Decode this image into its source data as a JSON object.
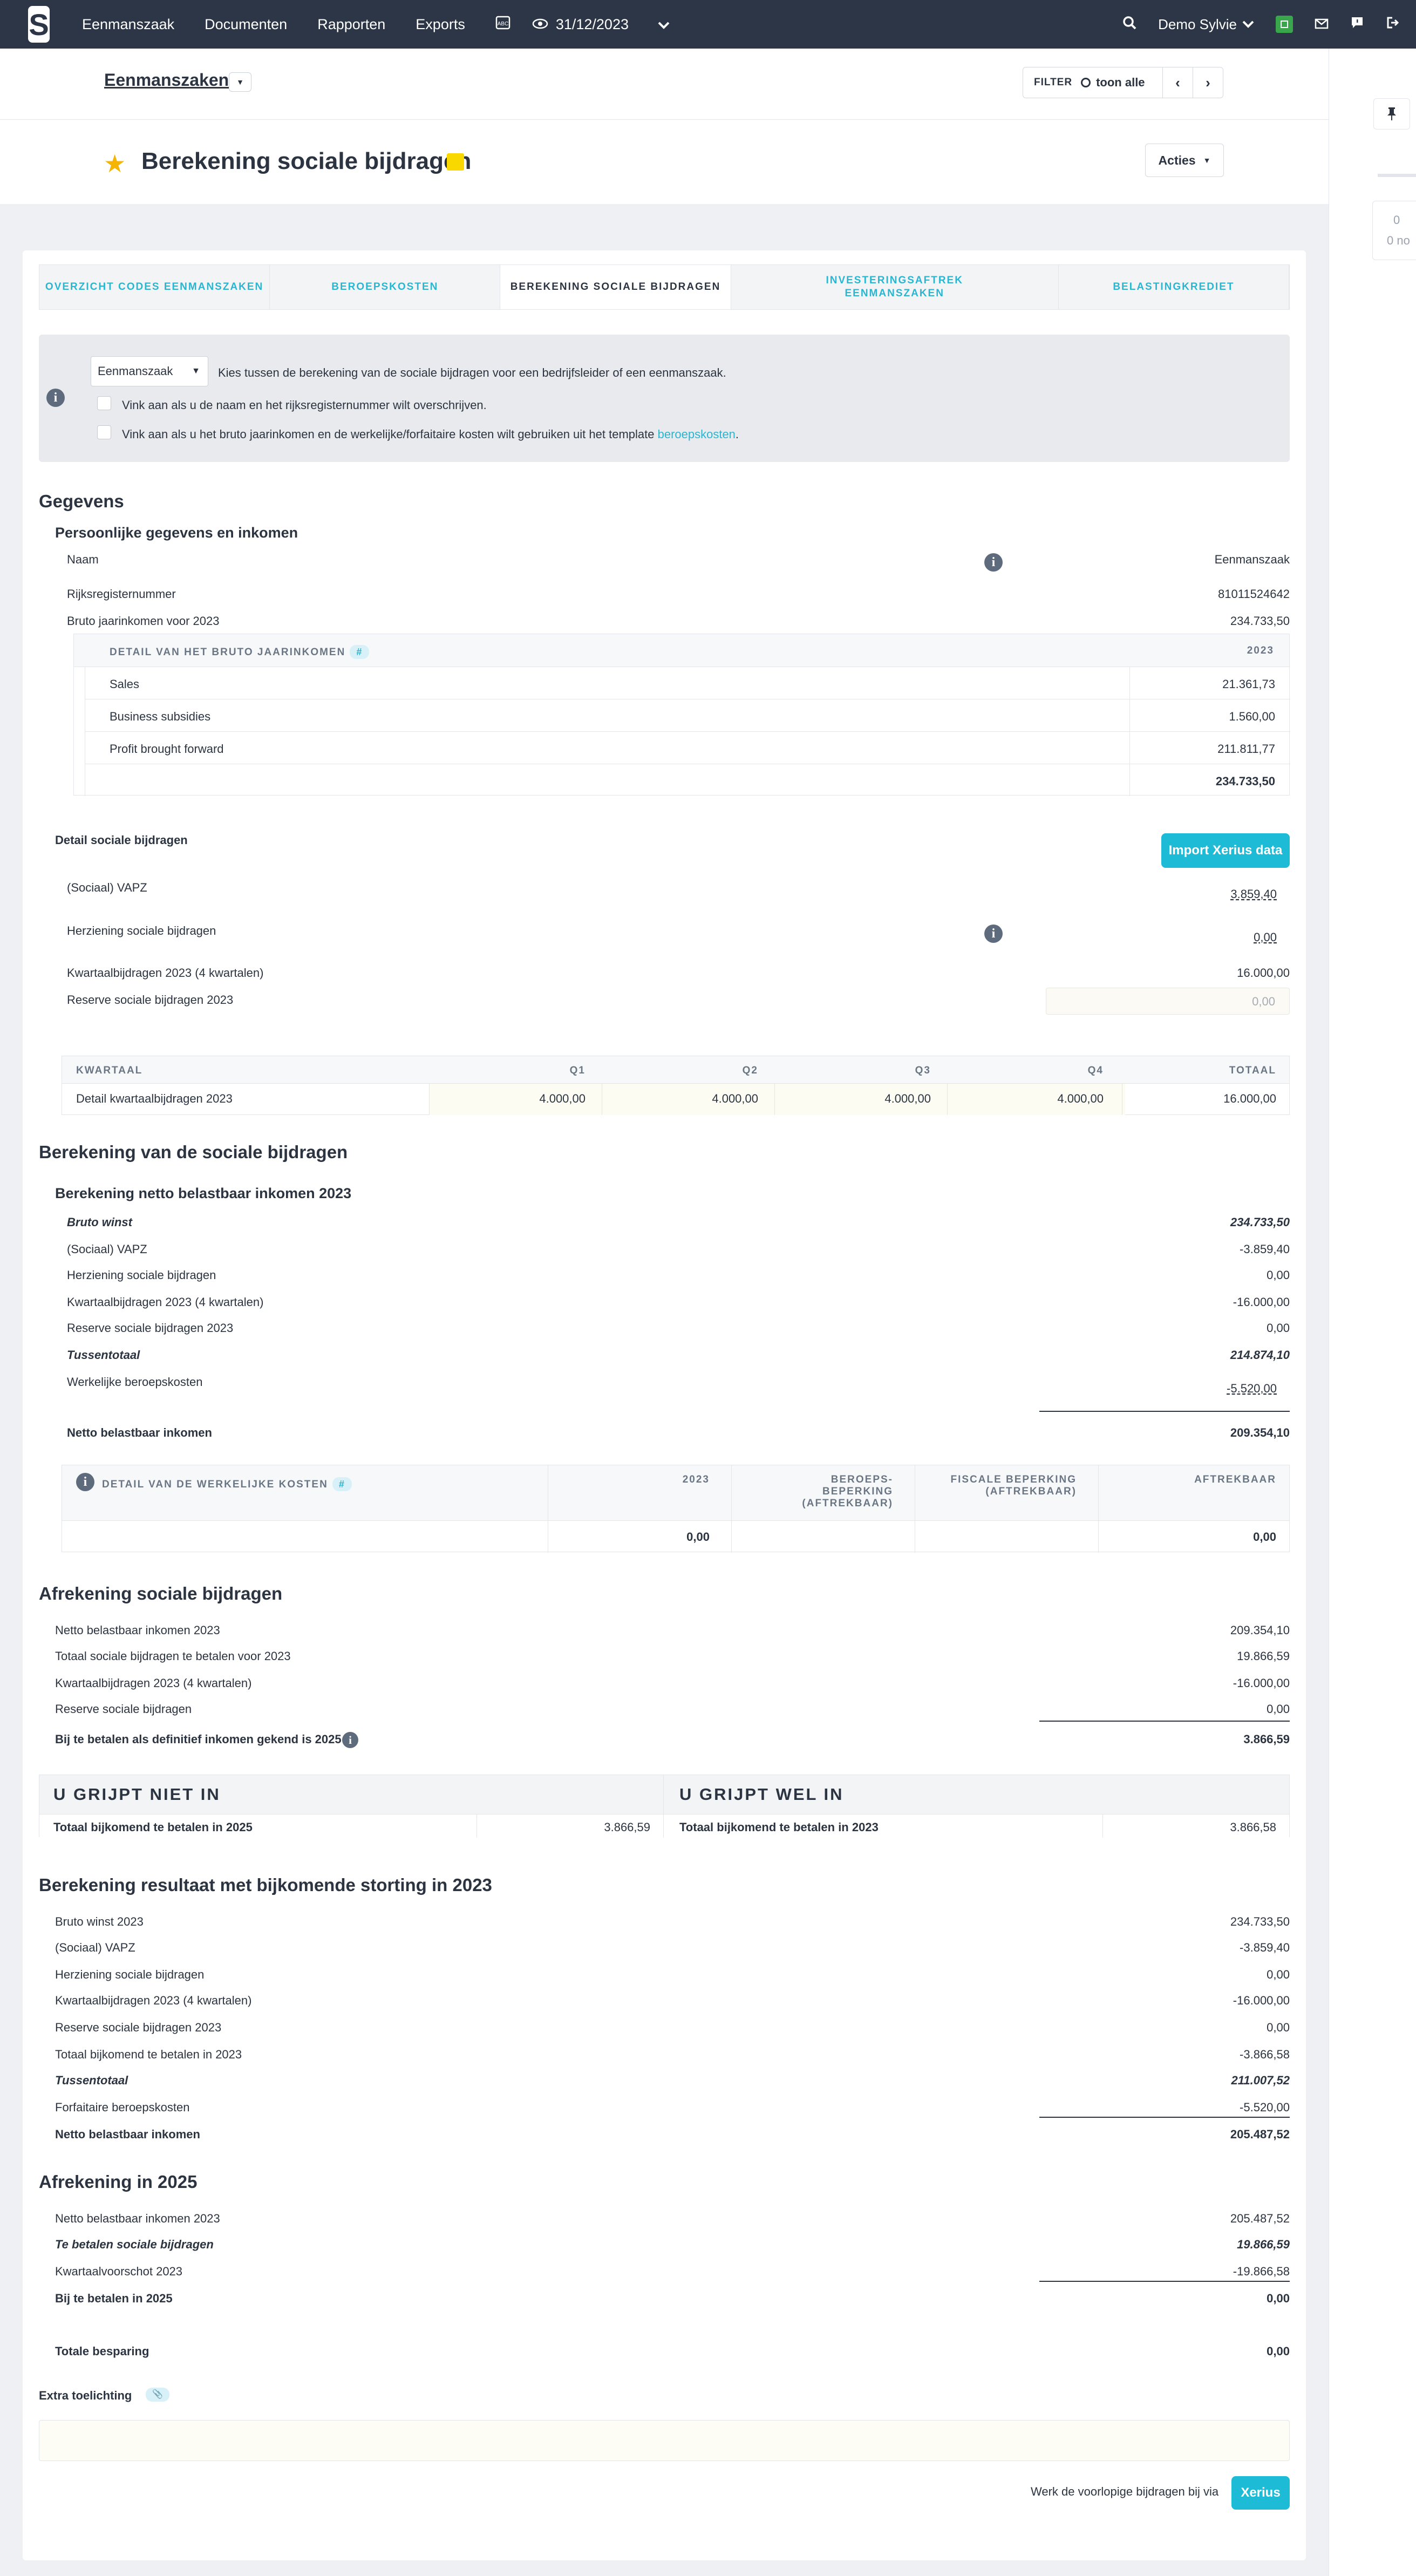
{
  "topbar": {
    "nav": [
      "Eenmanszaak",
      "Documenten",
      "Rapporten",
      "Exports"
    ],
    "date": "31/12/2023",
    "user": "Demo Sylvie"
  },
  "header": {
    "breadcrumb": "Eenmanszaken",
    "filter_label": "FILTER",
    "filter_value": "toon alle",
    "title": "Berekening sociale bijdragen",
    "actions": "Acties"
  },
  "right_panel": {
    "stub1": "0",
    "stub2": "0 no"
  },
  "tabs": [
    "OVERZICHT CODES EENMANSZAKEN",
    "BEROEPSKOSTEN",
    "BEREKENING SOCIALE BIJDRAGEN",
    "INVESTERINGSAFTREK EENMANSZAKEN",
    "BELASTINGKREDIET"
  ],
  "info": {
    "select": "Eenmanszaak",
    "select_hint": "Kies tussen de berekening van de sociale bijdragen voor een bedrijfsleider of een eenmanszaak.",
    "check1": "Vink aan als u de naam en het rijksregisternummer wilt overschrijven.",
    "check2": "Vink aan als u het bruto jaarinkomen en de werkelijke/forfaitaire kosten wilt gebruiken uit het template ",
    "check2_link": "beroepskosten",
    "check2_end": "."
  },
  "gegevens": {
    "title": "Gegevens",
    "sub": "Persoonlijke gegevens en inkomen",
    "naam_label": "Naam",
    "naam": "Eenmanszaak",
    "rr_label": "Rijksregisternummer",
    "rr": "81011524642",
    "bruto_label": "Bruto jaarinkomen voor 2023",
    "bruto": "234.733,50",
    "detail_header": "DETAIL VAN HET BRUTO JAARINKOMEN",
    "detail_year": "2023",
    "detail_rows": [
      {
        "label": "Sales",
        "value": "21.361,73"
      },
      {
        "label": "Business subsidies",
        "value": "1.560,00"
      },
      {
        "label": "Profit brought forward",
        "value": "211.811,77"
      }
    ],
    "detail_total": "234.733,50"
  },
  "social": {
    "title": "Detail sociale bijdragen",
    "import_btn": "Import Xerius data",
    "vapz_label": "(Sociaal) VAPZ",
    "vapz": "3.859,40",
    "herz_label": "Herziening sociale bijdragen",
    "herz": "0,00",
    "kw_label": "Kwartaalbijdragen 2023 (4 kwartalen)",
    "kw": "16.000,00",
    "res_label": "Reserve sociale bijdragen 2023",
    "res": "0,00",
    "q_headers": [
      "KWARTAAL",
      "Q1",
      "Q2",
      "Q3",
      "Q4",
      "TOTAAL"
    ],
    "q_row_label": "Detail kwartaalbijdragen 2023",
    "q_values": [
      "4.000,00",
      "4.000,00",
      "4.000,00",
      "4.000,00",
      "16.000,00"
    ]
  },
  "berekening": {
    "title": "Berekening van de sociale bijdragen",
    "sub": "Berekening netto belastbaar inkomen 2023",
    "rows": [
      [
        "Bruto winst",
        "234.733,50"
      ],
      [
        "(Sociaal) VAPZ",
        "-3.859,40"
      ],
      [
        "Herziening sociale bijdragen",
        "0,00"
      ],
      [
        "Kwartaalbijdragen 2023 (4 kwartalen)",
        "-16.000,00"
      ],
      [
        "Reserve sociale bijdragen 2023",
        "0,00"
      ],
      [
        "Tussentotaal",
        "214.874,10"
      ],
      [
        "Werkelijke beroepskosten",
        "-5.520,00"
      ]
    ],
    "netto_label": "Netto belastbaar inkomen",
    "netto": "209.354,10",
    "kosten_header": "DETAIL VAN DE WERKELIJKE KOSTEN",
    "kosten_cols": [
      "2023",
      "BEROEPS-\nBEPERKING\n(AFTREKBAAR)",
      "FISCALE BEPERKING\n(AFTREKBAAR)",
      "AFTREKBAAR"
    ],
    "kosten_vals": [
      "0,00",
      "0,00"
    ]
  },
  "afrekening": {
    "title": "Afrekening sociale bijdragen",
    "rows": [
      [
        "Netto belastbaar inkomen 2023",
        "209.354,10"
      ],
      [
        "Totaal sociale bijdragen te betalen voor 2023",
        "19.866,59"
      ],
      [
        "Kwartaalbijdragen 2023 (4 kwartalen)",
        "-16.000,00"
      ],
      [
        "Reserve sociale bijdragen",
        "0,00"
      ]
    ],
    "final_label": "Bij te betalen als definitief inkomen gekend is 2025",
    "final": "3.866,59",
    "niet_title": "U GRIJPT NIET IN",
    "niet_label": "Totaal bijkomend te betalen in 2025",
    "niet_val": "3.866,59",
    "wel_title": "U GRIJPT WEL IN",
    "wel_label": "Totaal bijkomend te betalen in 2023",
    "wel_val": "3.866,58"
  },
  "resultaat": {
    "title": "Berekening resultaat met bijkomende storting in 2023",
    "rows": [
      [
        "Bruto winst 2023",
        "234.733,50"
      ],
      [
        "(Sociaal) VAPZ",
        "-3.859,40"
      ],
      [
        "Herziening sociale bijdragen",
        "0,00"
      ],
      [
        "Kwartaalbijdragen 2023 (4 kwartalen)",
        "-16.000,00"
      ],
      [
        "Reserve sociale bijdragen 2023",
        "0,00"
      ],
      [
        "Totaal bijkomend te betalen in 2023",
        "-3.866,58"
      ],
      [
        "Tussentotaal",
        "211.007,52"
      ],
      [
        "Forfaitaire beroepskosten",
        "-5.520,00"
      ]
    ],
    "netto_label": "Netto belastbaar inkomen",
    "netto": "205.487,52"
  },
  "af2025": {
    "title": "Afrekening in 2025",
    "rows": [
      [
        "Netto belastbaar inkomen 2023",
        "205.487,52"
      ],
      [
        "Te betalen sociale bijdragen",
        "19.866,59"
      ],
      [
        "Kwartaalvoorschot 2023",
        "-19.866,58"
      ]
    ],
    "bij_label": "Bij te betalen in 2025",
    "bij": "0,00",
    "bes_label": "Totale besparing",
    "bes": "0,00"
  },
  "extra": {
    "label": "Extra toelichting",
    "footer_text": "Werk de voorlopige bijdragen bij via",
    "xerius_btn": "Xerius"
  }
}
